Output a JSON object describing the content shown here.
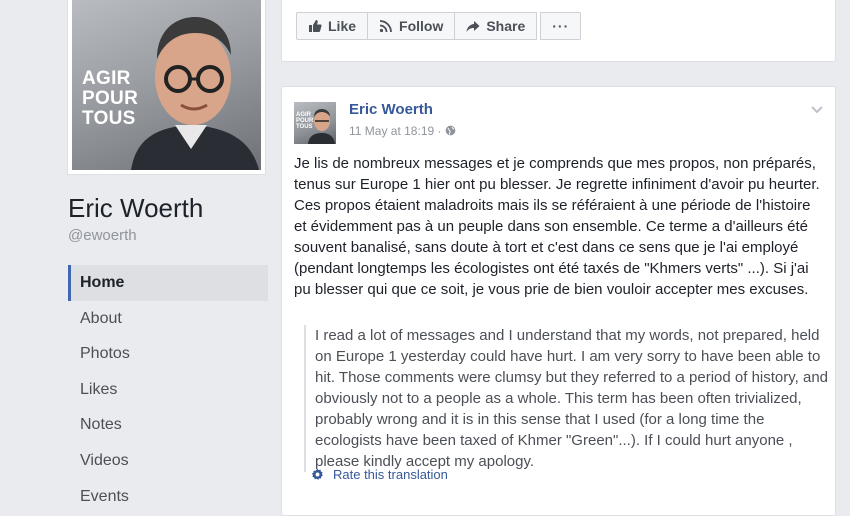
{
  "profile": {
    "slogan_lines": [
      "AGIR",
      "POUR",
      "TOUS"
    ],
    "name": "Eric Woerth",
    "handle": "@ewoerth"
  },
  "nav": {
    "items": [
      "Home",
      "About",
      "Photos",
      "Likes",
      "Notes",
      "Videos",
      "Events"
    ]
  },
  "actions": {
    "like": "Like",
    "follow": "Follow",
    "share": "Share",
    "more": "···"
  },
  "post": {
    "author": "Eric Woerth",
    "avatar_text": [
      "AGIR",
      "POUR",
      "TOUS"
    ],
    "time": "11 May at 18:19 ·",
    "body": "Je lis de nombreux messages et je comprends que mes propos, non préparés, tenus sur Europe 1 hier ont pu blesser. Je regrette infiniment d'avoir pu heurter. Ces propos étaient maladroits mais ils se référaient à une période de l'histoire et évidemment pas à un peuple dans son ensemble. Ce terme a d'ailleurs été souvent banalisé, sans doute à tort et c'est dans ce sens que je l'ai employé (pendant longtemps les écologistes ont été taxés de \"Khmers verts\" ...). Si j'ai pu blesser qui que ce soit, je vous prie de bien vouloir accepter mes excuses.",
    "translation": "I read a lot of messages and I understand that my words, not prepared, held on Europe 1 yesterday could have hurt. I am very sorry to have been able to hit. Those comments were clumsy but they referred to a period of history, and obviously not to a people as a whole. This term has been often trivialized, probably wrong and it is in this sense that I used (for a long time the ecologists have been taxed of Khmer \"Green\"...). If I could hurt anyone , please kindly accept my apology.",
    "rate_label": "Rate this translation"
  },
  "colors": {
    "link": "#365899",
    "accent": "#4267b2",
    "background": "#e9ebee"
  },
  "icons": [
    "like-icon",
    "rss-icon",
    "share-arrow-icon",
    "globe-icon",
    "chevron-down-icon",
    "gear-icon"
  ]
}
